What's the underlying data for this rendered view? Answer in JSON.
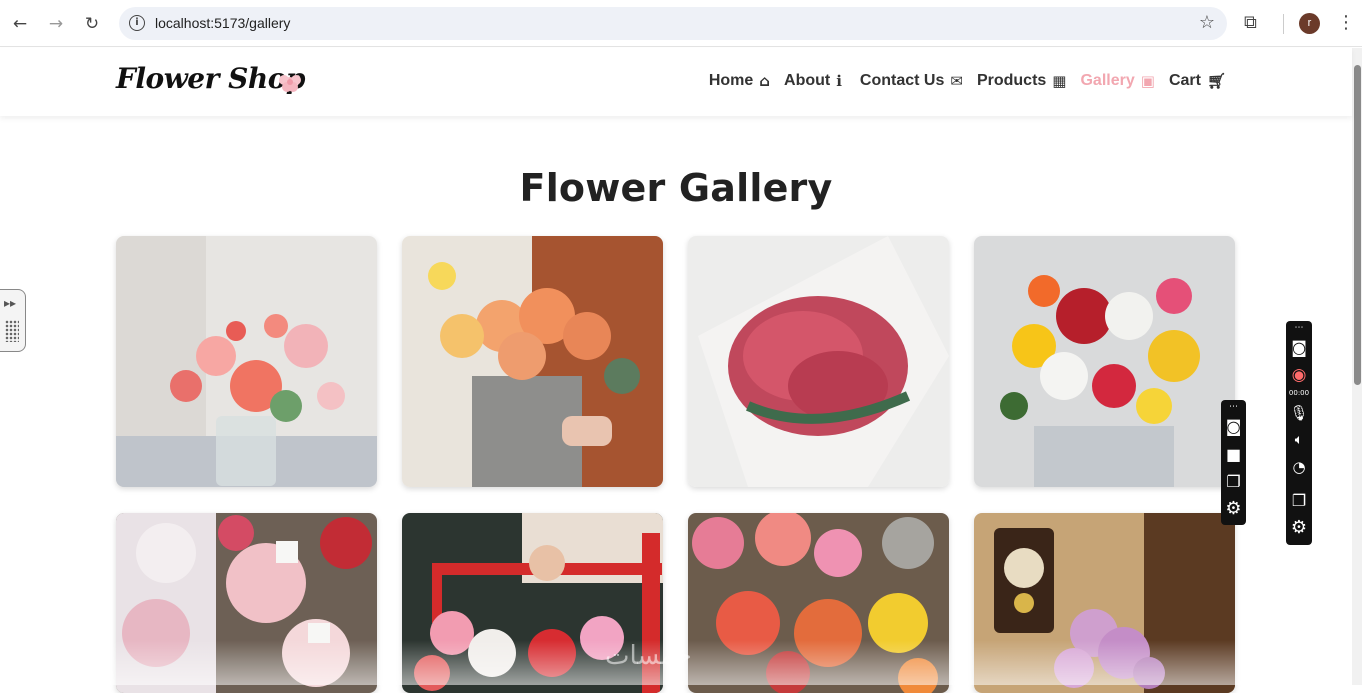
{
  "browser": {
    "url": "localhost:5173/gallery",
    "profile_initial": "r"
  },
  "site": {
    "logo_text": "Flower Shop",
    "nav": [
      {
        "label": "Home",
        "icon": "home-icon"
      },
      {
        "label": "About",
        "icon": "info-icon"
      },
      {
        "label": "Contact Us",
        "icon": "envelope-icon"
      },
      {
        "label": "Products",
        "icon": "boxes-icon"
      },
      {
        "label": "Gallery",
        "icon": "images-icon",
        "active": true
      },
      {
        "label": "Cart",
        "icon": "cart-icon"
      }
    ],
    "active_color": "#f2a7b0"
  },
  "main": {
    "title": "Flower Gallery",
    "images": [
      {
        "subject": "pink and orange rose bouquet in glass vase"
      },
      {
        "subject": "orange roses hatbox held by person"
      },
      {
        "subject": "red tulips wrapped in white paper"
      },
      {
        "subject": "mixed bright bouquet with sunflowers and roses"
      },
      {
        "subject": "flower market bouquets with price tags"
      },
      {
        "subject": "person carrying red cart of tulips"
      },
      {
        "subject": "market stall with roses and tulips"
      },
      {
        "subject": "lilac branch beside wall clock"
      }
    ]
  },
  "recorder": {
    "timer": "00:00"
  },
  "watermark_text": "خمسات"
}
